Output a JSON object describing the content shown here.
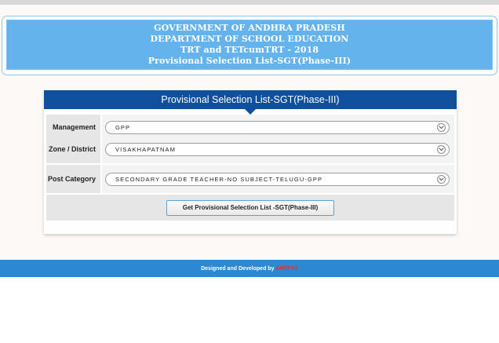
{
  "header": {
    "lines": [
      "GOVERNMENT OF ANDHRA PRADESH",
      "DEPARTMENT OF SCHOOL EDUCATION",
      "TRT and TETcumTRT - 2018",
      "Provisional Selection List-SGT(Phase-III)"
    ]
  },
  "panel": {
    "title": "Provisional Selection List-SGT(Phase-III)",
    "fields": [
      {
        "label": "Management",
        "value": "GPP"
      },
      {
        "label": "Zone / District",
        "value": "VISAKHAPATNAM"
      },
      {
        "label": "Post Category",
        "value": "SECONDARY GRADE TEACHER-NO SUBJECT-TELUGU-GPP"
      }
    ],
    "submit_label": "Get Provisional Selection List -SGT(Phase-III)"
  },
  "footer": {
    "text": "Designed and Developed by",
    "brand": "APCFSS"
  },
  "colors": {
    "header_bg": "#64b3ec",
    "panel_head_bg": "#0f4f9c",
    "footer_bg": "#2d88d2",
    "brand": "#e0302e"
  }
}
